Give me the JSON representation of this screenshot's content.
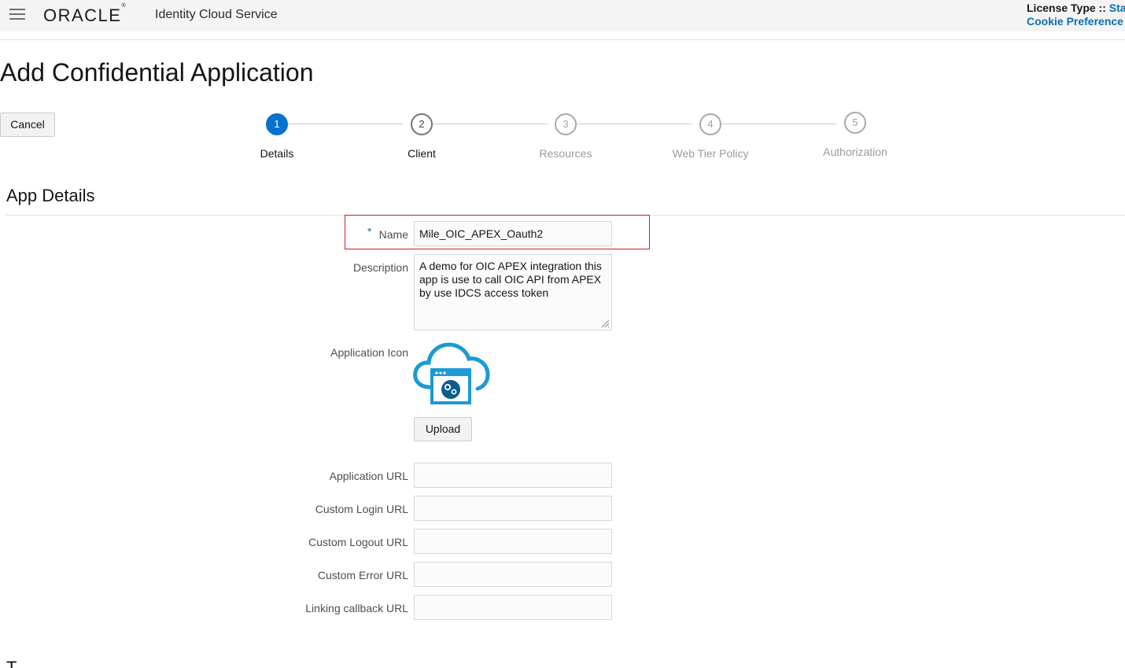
{
  "header": {
    "logo": "ORACLE",
    "product": "Identity Cloud Service",
    "license_prefix": "License Type :: ",
    "license_value": "Sta",
    "cookie_link": "Cookie Preference"
  },
  "page": {
    "title": "Add Confidential Application",
    "cancel_label": "Cancel"
  },
  "train": {
    "steps": [
      {
        "number": "1",
        "label": "Details",
        "state": "active"
      },
      {
        "number": "2",
        "label": "Client",
        "state": "visited"
      },
      {
        "number": "3",
        "label": "Resources",
        "state": "inactive"
      },
      {
        "number": "4",
        "label": "Web Tier Policy",
        "state": "inactive"
      },
      {
        "number": "5",
        "label": "Authorization",
        "state": "inactive"
      }
    ]
  },
  "section": {
    "title": "App Details"
  },
  "form": {
    "required_marker": "*",
    "name_label": "Name",
    "name_value": "Mile_OIC_APEX_Oauth2",
    "description_label": "Description",
    "description_value": "A demo for OIC APEX integration this app is use to call OIC API from APEX by use IDCS access token",
    "icon_label": "Application Icon",
    "icon_name": "cloud-app-gear-icon",
    "upload_label": "Upload",
    "app_url_label": "Application URL",
    "app_url_value": "",
    "custom_login_label": "Custom Login URL",
    "custom_login_value": "",
    "custom_logout_label": "Custom Logout URL",
    "custom_logout_value": "",
    "custom_error_label": "Custom Error URL",
    "custom_error_value": "",
    "linking_callback_label": "Linking callback URL",
    "linking_callback_value": ""
  },
  "next_section": {
    "title": "T"
  },
  "colors": {
    "accent": "#0572ce",
    "highlight": "#d11a2a",
    "icon_blue": "#1b9ad6",
    "icon_dark": "#0a5d8c"
  }
}
